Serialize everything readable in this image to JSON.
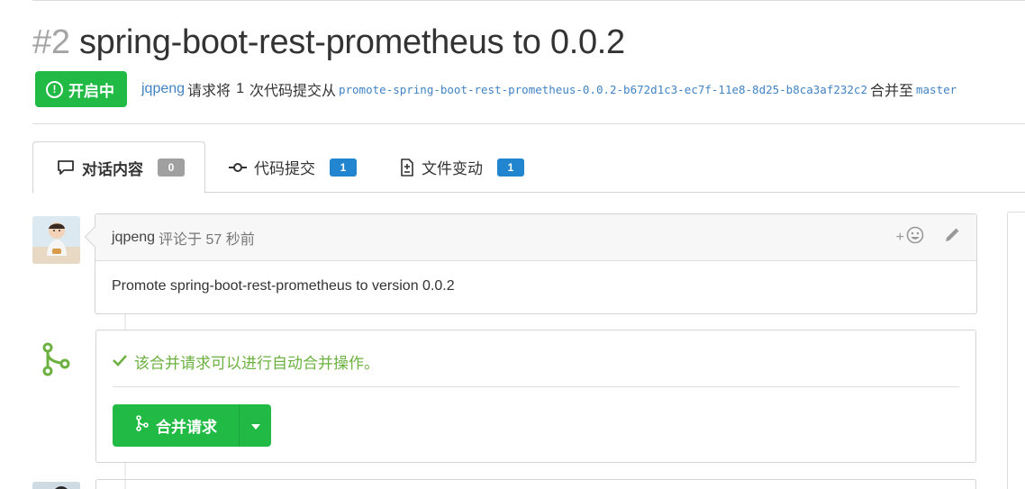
{
  "pr": {
    "number": "#2",
    "title": "spring-boot-rest-prometheus to 0.0.2",
    "status": "开启中",
    "author": "jqpeng",
    "text_request": "请求将",
    "commit_count": "1",
    "text_commits_from": "次代码提交从",
    "source_branch": "promote-spring-boot-rest-prometheus-0.0.2-b672d1c3-ec7f-11e8-8d25-b8ca3af232c2",
    "text_merge_into": "合并至",
    "target_branch": "master"
  },
  "tabs": [
    {
      "label": "对话内容",
      "count": "0",
      "icon": "comment-icon"
    },
    {
      "label": "代码提交",
      "count": "1",
      "icon": "commit-icon"
    },
    {
      "label": "文件变动",
      "count": "1",
      "icon": "file-diff-icon"
    }
  ],
  "comment": {
    "author": "jqpeng",
    "meta": "评论于 57 秒前",
    "body": "Promote spring-boot-rest-prometheus to version 0.0.2",
    "add_reaction_label": "+"
  },
  "merge": {
    "message": "该合并请求可以进行自动合并操作。",
    "button_label": "合并请求"
  },
  "colors": {
    "green": "#21ba45",
    "link": "#4183c4",
    "success_text": "#6cb140",
    "badge_blue": "#2185d0",
    "badge_grey": "#a0a0a0"
  }
}
